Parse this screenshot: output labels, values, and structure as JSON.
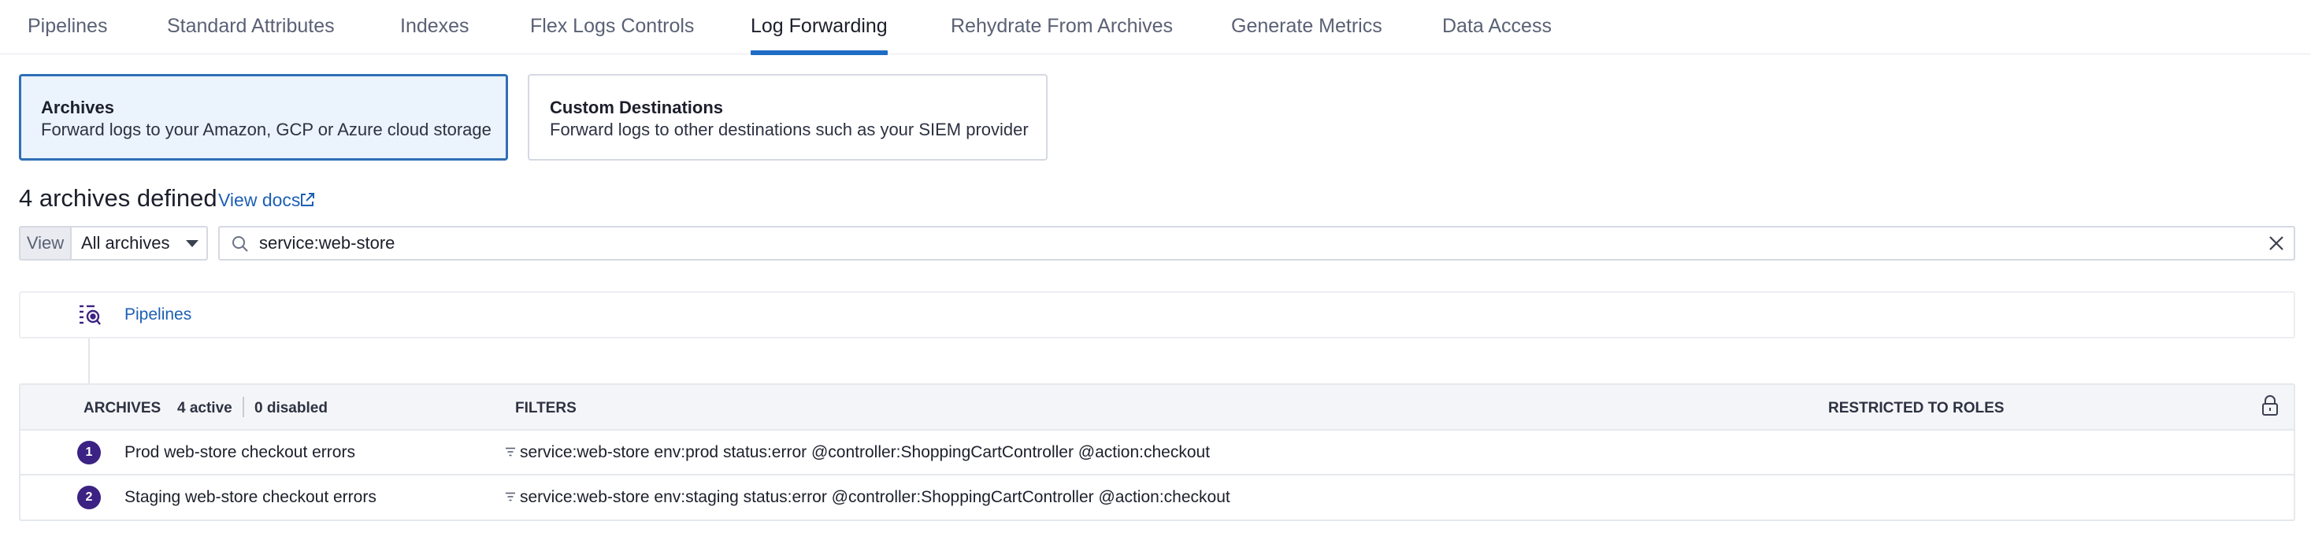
{
  "tabs": [
    {
      "label": "Pipelines",
      "active": false
    },
    {
      "label": "Standard Attributes",
      "active": false
    },
    {
      "label": "Indexes",
      "active": false
    },
    {
      "label": "Flex Logs Controls",
      "active": false
    },
    {
      "label": "Log Forwarding",
      "active": true
    },
    {
      "label": "Rehydrate From Archives",
      "active": false
    },
    {
      "label": "Generate Metrics",
      "active": false
    },
    {
      "label": "Data Access",
      "active": false
    }
  ],
  "cards": [
    {
      "title": "Archives",
      "description": "Forward logs to your Amazon, GCP or Azure cloud storage",
      "selected": true
    },
    {
      "title": "Custom Destinations",
      "description": "Forward logs to other destinations such as your SIEM provider",
      "selected": false
    }
  ],
  "summary": {
    "heading": "4 archives defined",
    "view_docs": "View docs"
  },
  "filter_bar": {
    "view_label": "View",
    "view_value": "All archives",
    "search_value": "service:web-store"
  },
  "pipelines": {
    "label": "Pipelines"
  },
  "table": {
    "col_archives": "ARCHIVES",
    "active_count": "4 active",
    "disabled_count": "0 disabled",
    "col_filters": "FILTERS",
    "col_roles": "RESTRICTED TO ROLES",
    "rows": [
      {
        "index": "1",
        "name": "Prod web-store checkout errors",
        "filter": "service:web-store env:prod status:error @controller:ShoppingCartController @action:checkout"
      },
      {
        "index": "2",
        "name": "Staging web-store checkout errors",
        "filter": "service:web-store env:staging status:error @controller:ShoppingCartController @action:checkout"
      }
    ]
  },
  "colors": {
    "accent": "#1e6cc4",
    "link": "#1d5fb5",
    "selected_card_border": "#2f6fb7",
    "selected_card_bg": "#ebf3fc",
    "badge": "#3b2283"
  },
  "icons": [
    "external-link-icon",
    "chevron-down-icon",
    "search-icon",
    "close-icon",
    "pipelines-icon",
    "lock-icon",
    "filter-icon"
  ]
}
